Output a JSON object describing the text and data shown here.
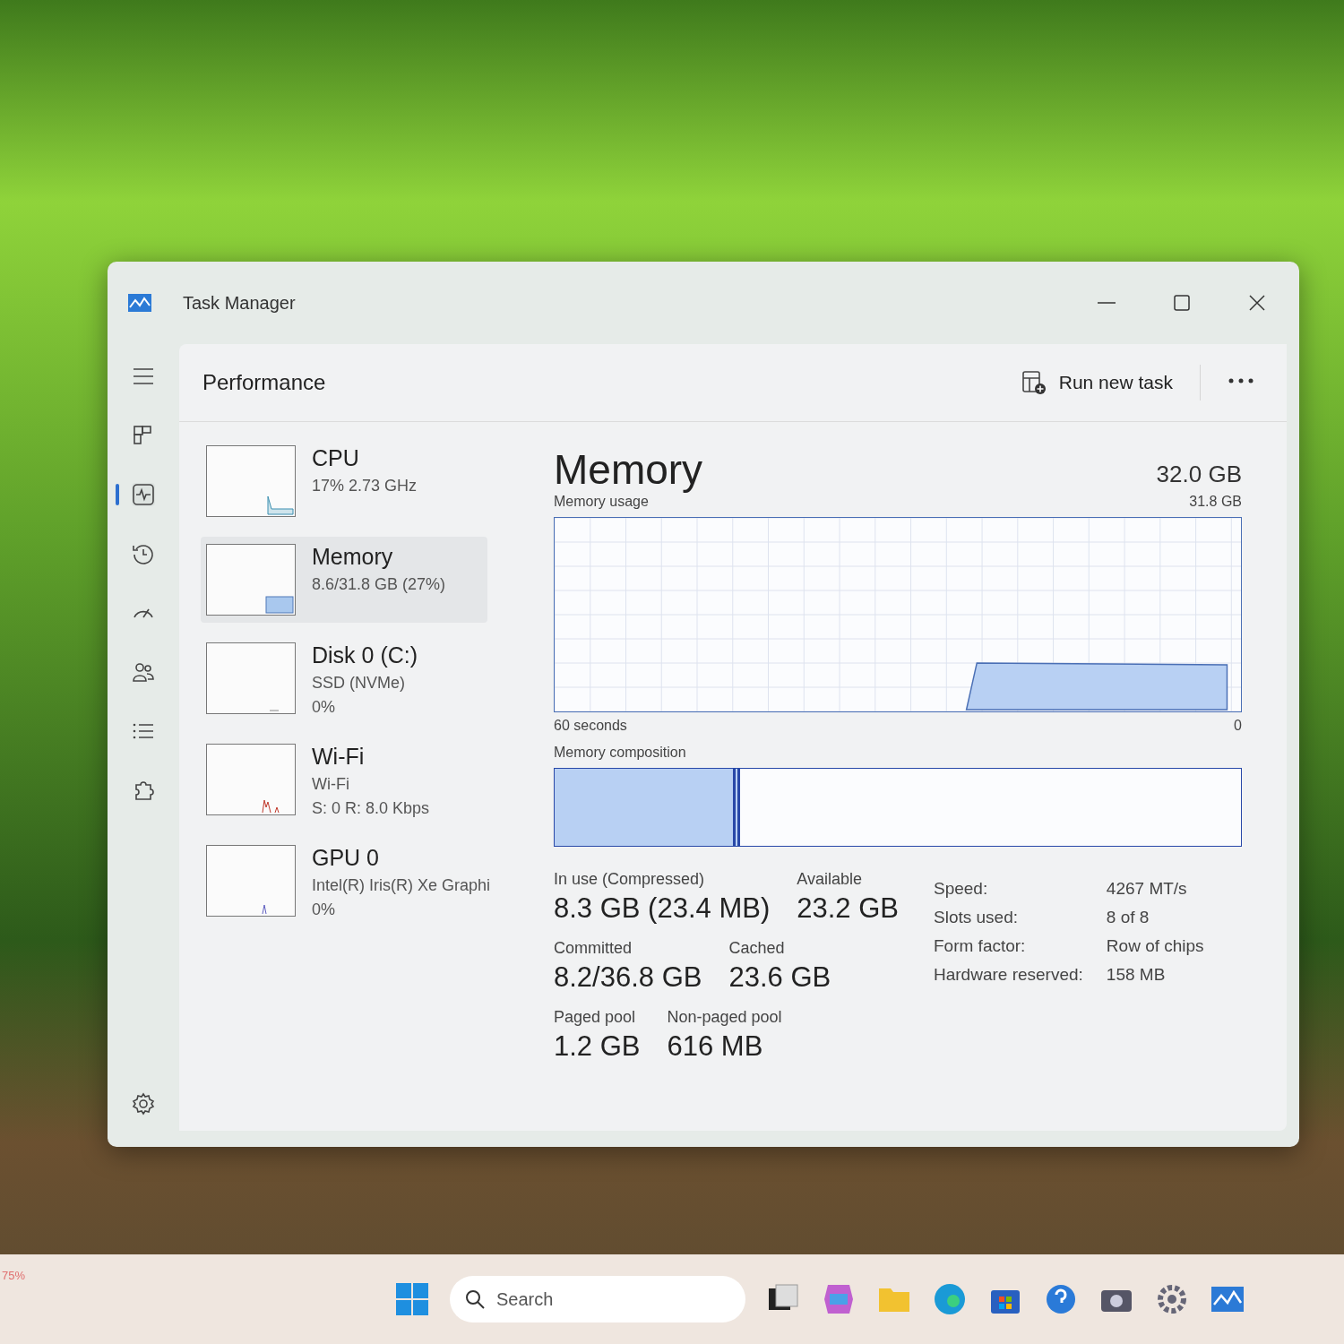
{
  "window": {
    "title": "Task Manager"
  },
  "nav": [
    {
      "kind": "menu",
      "selected": false
    },
    {
      "kind": "processes",
      "selected": false
    },
    {
      "kind": "performance",
      "selected": true
    },
    {
      "kind": "history",
      "selected": false
    },
    {
      "kind": "startup",
      "selected": false
    },
    {
      "kind": "users",
      "selected": false
    },
    {
      "kind": "details",
      "selected": false
    },
    {
      "kind": "services",
      "selected": false
    },
    {
      "kind": "settings",
      "selected": false
    }
  ],
  "header": {
    "title": "Performance",
    "run_new_task": "Run new task"
  },
  "devices": [
    {
      "name": "CPU",
      "lines": [
        "17%  2.73 GHz"
      ],
      "selected": false
    },
    {
      "name": "Memory",
      "lines": [
        "8.6/31.8 GB (27%)"
      ],
      "selected": true
    },
    {
      "name": "Disk 0 (C:)",
      "lines": [
        "SSD (NVMe)",
        "0%"
      ],
      "selected": false
    },
    {
      "name": "Wi-Fi",
      "lines": [
        "Wi-Fi",
        "S: 0 R: 8.0 Kbps"
      ],
      "selected": false
    },
    {
      "name": "GPU 0",
      "lines": [
        "Intel(R) Iris(R) Xe Graphi",
        "0%"
      ],
      "selected": false
    }
  ],
  "detail": {
    "title": "Memory",
    "total": "32.0 GB",
    "usage_label": "Memory usage",
    "usage_max": "31.8 GB",
    "time_span": "60 seconds",
    "usage_min": "0",
    "composition": {
      "label": "Memory composition",
      "level": 0.26
    },
    "stats": [
      [
        {
          "label": "In use (Compressed)",
          "value": "8.3 GB (23.4 MB)"
        },
        {
          "label": "Available",
          "value": "23.2 GB"
        }
      ],
      [
        {
          "label": "Committed",
          "value": "8.2/36.8 GB"
        },
        {
          "label": "Cached",
          "value": "23.6 GB"
        }
      ],
      [
        {
          "label": "Paged pool",
          "value": "1.2 GB"
        },
        {
          "label": "Non-paged pool",
          "value": "616 MB"
        }
      ]
    ],
    "specs": [
      {
        "label": "Speed:",
        "value": "4267 MT/s"
      },
      {
        "label": "Slots used:",
        "value": "8 of 8"
      },
      {
        "label": "Form factor:",
        "value": "Row of chips"
      },
      {
        "label": "Hardware reserved:",
        "value": "158 MB"
      }
    ]
  },
  "taskbar": {
    "corner_text": "75%",
    "search": {
      "placeholder": "Search"
    }
  }
}
